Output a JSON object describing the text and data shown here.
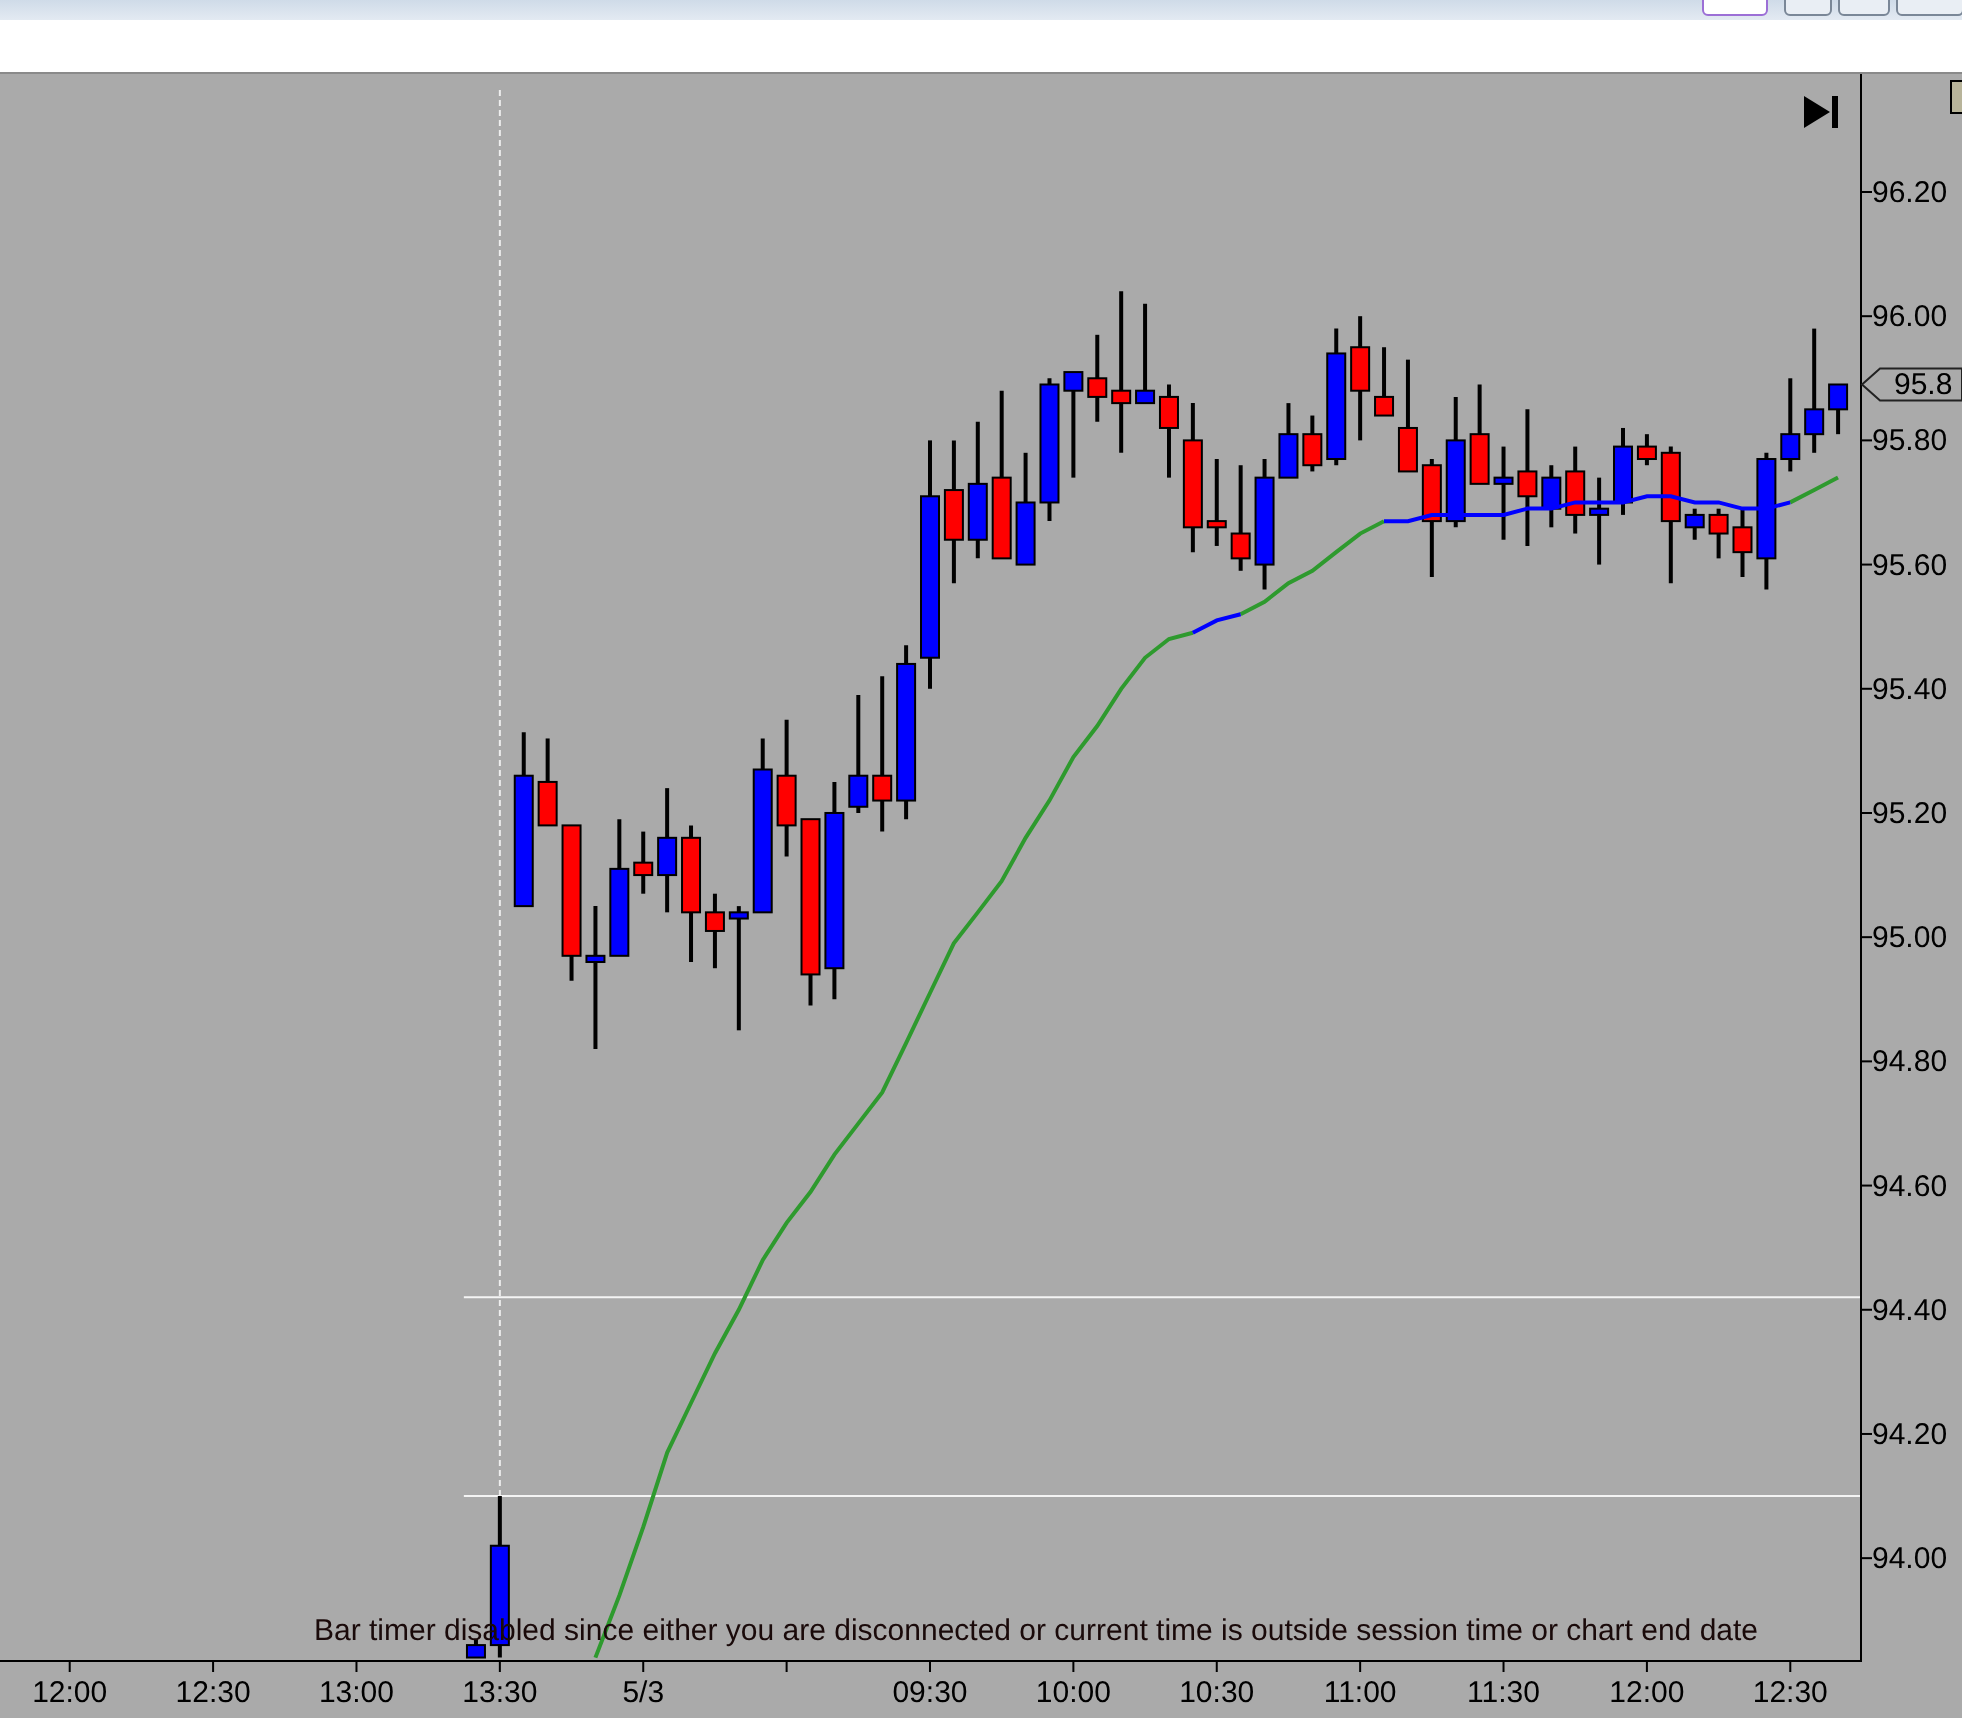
{
  "window": {
    "buttons": [
      {
        "kind": "plain"
      },
      {
        "kind": "minimize"
      },
      {
        "kind": "restore"
      },
      {
        "kind": "close"
      }
    ]
  },
  "chart": {
    "status_message": "Bar timer disabled since either you are disconnected or current time is outside session time or chart end date",
    "price_marker": "95.8",
    "chart_data": {
      "type": "candlestick",
      "categories": [
        null,
        null,
        "12:00",
        null,
        null,
        null,
        null,
        null,
        "12:30",
        null,
        null,
        null,
        null,
        null,
        "13:00",
        null,
        null,
        null,
        null,
        null,
        "13:30",
        null,
        null,
        null,
        null,
        null,
        "5/3",
        null,
        null,
        null,
        null,
        null,
        null,
        null,
        null,
        null,
        null,
        null,
        "09:30",
        null,
        null,
        null,
        null,
        null,
        "10:00",
        null,
        null,
        null,
        null,
        null,
        "10:30",
        null,
        null,
        null,
        null,
        null,
        "11:00",
        null,
        null,
        null,
        null,
        null,
        "11:30",
        null,
        null,
        null,
        null,
        null,
        "12:00",
        null,
        null,
        null,
        null,
        null,
        "12:30",
        null,
        null
      ],
      "ylim": [
        93.836,
        96.39
      ],
      "yticks": [
        {
          "value": 94,
          "label": "94.00"
        },
        {
          "value": 94.2,
          "label": "94.20"
        },
        {
          "value": 94.4,
          "label": "94.40"
        },
        {
          "value": 94.6,
          "label": "94.60"
        },
        {
          "value": 94.8,
          "label": "94.80"
        },
        {
          "value": 95,
          "label": "95.00"
        },
        {
          "value": 95.2,
          "label": "95.20"
        },
        {
          "value": 95.4,
          "label": "95.40"
        },
        {
          "value": 95.6,
          "label": "95.60"
        },
        {
          "value": 95.8,
          "label": "95.80"
        },
        {
          "value": 96,
          "label": "96.00"
        },
        {
          "value": 96.2,
          "label": "96.20"
        }
      ],
      "ohlc": [
        null,
        null,
        null,
        null,
        null,
        null,
        null,
        null,
        null,
        null,
        null,
        null,
        null,
        null,
        null,
        null,
        null,
        null,
        null,
        [
          93.84,
          93.87,
          93.84,
          93.86
        ],
        [
          93.86,
          94.1,
          93.84,
          94.02
        ],
        [
          95.05,
          95.33,
          95.05,
          95.26
        ],
        [
          95.25,
          95.32,
          95.18,
          95.18
        ],
        [
          95.18,
          95.18,
          94.93,
          94.97
        ],
        [
          94.96,
          95.05,
          94.82,
          94.97
        ],
        [
          94.97,
          95.19,
          94.97,
          95.11
        ],
        [
          95.12,
          95.17,
          95.07,
          95.1
        ],
        [
          95.1,
          95.24,
          95.04,
          95.16
        ],
        [
          95.16,
          95.18,
          94.96,
          95.04
        ],
        [
          95.04,
          95.07,
          94.95,
          95.01
        ],
        [
          95.03,
          95.05,
          94.85,
          95.04
        ],
        [
          95.04,
          95.32,
          95.04,
          95.27
        ],
        [
          95.26,
          95.35,
          95.13,
          95.18
        ],
        [
          95.19,
          95.19,
          94.89,
          94.94
        ],
        [
          94.95,
          95.25,
          94.9,
          95.2
        ],
        [
          95.21,
          95.39,
          95.2,
          95.26
        ],
        [
          95.26,
          95.42,
          95.17,
          95.22
        ],
        [
          95.22,
          95.47,
          95.19,
          95.44
        ],
        [
          95.45,
          95.8,
          95.4,
          95.71
        ],
        [
          95.72,
          95.8,
          95.57,
          95.64
        ],
        [
          95.64,
          95.83,
          95.61,
          95.73
        ],
        [
          95.74,
          95.88,
          95.61,
          95.61
        ],
        [
          95.6,
          95.78,
          95.6,
          95.7
        ],
        [
          95.7,
          95.9,
          95.67,
          95.89
        ],
        [
          95.88,
          95.91,
          95.74,
          95.91
        ],
        [
          95.9,
          95.97,
          95.83,
          95.87
        ],
        [
          95.88,
          96.04,
          95.78,
          95.86
        ],
        [
          95.86,
          96.02,
          95.86,
          95.88
        ],
        [
          95.87,
          95.89,
          95.74,
          95.82
        ],
        [
          95.8,
          95.86,
          95.62,
          95.66
        ],
        [
          95.67,
          95.77,
          95.63,
          95.66
        ],
        [
          95.65,
          95.76,
          95.59,
          95.61
        ],
        [
          95.6,
          95.77,
          95.56,
          95.74
        ],
        [
          95.74,
          95.86,
          95.74,
          95.81
        ],
        [
          95.81,
          95.84,
          95.75,
          95.76
        ],
        [
          95.77,
          95.98,
          95.76,
          95.94
        ],
        [
          95.95,
          96.0,
          95.8,
          95.88
        ],
        [
          95.87,
          95.95,
          95.84,
          95.84
        ],
        [
          95.82,
          95.93,
          95.75,
          95.75
        ],
        [
          95.76,
          95.77,
          95.58,
          95.67
        ],
        [
          95.67,
          95.87,
          95.66,
          95.8
        ],
        [
          95.81,
          95.89,
          95.73,
          95.73
        ],
        [
          95.73,
          95.79,
          95.64,
          95.74
        ],
        [
          95.75,
          95.85,
          95.63,
          95.71
        ],
        [
          95.69,
          95.76,
          95.66,
          95.74
        ],
        [
          95.75,
          95.79,
          95.65,
          95.68
        ],
        [
          95.68,
          95.74,
          95.6,
          95.69
        ],
        [
          95.7,
          95.82,
          95.68,
          95.79
        ],
        [
          95.79,
          95.81,
          95.76,
          95.77
        ],
        [
          95.78,
          95.79,
          95.57,
          95.67
        ],
        [
          95.66,
          95.69,
          95.64,
          95.68
        ],
        [
          95.68,
          95.69,
          95.61,
          95.65
        ],
        [
          95.66,
          95.69,
          95.58,
          95.62
        ],
        [
          95.61,
          95.78,
          95.56,
          95.77
        ],
        [
          95.77,
          95.9,
          95.75,
          95.81
        ],
        [
          95.81,
          95.98,
          95.78,
          95.85
        ],
        [
          95.85,
          95.89,
          95.81,
          95.89
        ]
      ],
      "series": [
        {
          "type": "line",
          "color": "#2e9a2e",
          "values": [
            null,
            null,
            null,
            null,
            null,
            null,
            null,
            null,
            null,
            null,
            null,
            null,
            null,
            null,
            null,
            null,
            null,
            null,
            null,
            null,
            null,
            null,
            null,
            null,
            93.84,
            93.94,
            94.05,
            94.17,
            94.25,
            94.33,
            94.4,
            94.48,
            94.54,
            94.59,
            94.65,
            94.7,
            94.75,
            94.83,
            94.91,
            94.99,
            95.04,
            95.09,
            95.16,
            95.22,
            95.29,
            95.34,
            95.4,
            95.45,
            95.48,
            95.49,
            null,
            95.52,
            95.54,
            95.57,
            95.59,
            95.62,
            95.65,
            95.67,
            null,
            null,
            null,
            null,
            null,
            null,
            null,
            null,
            null,
            null,
            null,
            null,
            null,
            null,
            null,
            null,
            95.7,
            95.72,
            95.74
          ]
        },
        {
          "type": "line",
          "color": "#0000ff",
          "values": [
            null,
            null,
            null,
            null,
            null,
            null,
            null,
            null,
            null,
            null,
            null,
            null,
            null,
            null,
            null,
            null,
            null,
            null,
            null,
            null,
            null,
            null,
            null,
            null,
            null,
            null,
            null,
            null,
            null,
            null,
            null,
            null,
            null,
            null,
            null,
            null,
            null,
            null,
            null,
            null,
            null,
            null,
            null,
            null,
            null,
            null,
            null,
            null,
            null,
            95.49,
            95.51,
            95.52,
            null,
            null,
            null,
            null,
            null,
            95.67,
            95.67,
            95.68,
            95.68,
            95.68,
            95.68,
            95.69,
            95.69,
            95.7,
            95.7,
            95.7,
            95.71,
            95.71,
            95.7,
            95.7,
            95.69,
            95.69,
            95.7,
            null,
            null
          ]
        }
      ],
      "ref_lines": [
        {
          "axis": "x",
          "value": "13:30"
        },
        {
          "axis": "y",
          "value": 94.42
        },
        {
          "axis": "y",
          "value": 94.1
        }
      ]
    }
  }
}
